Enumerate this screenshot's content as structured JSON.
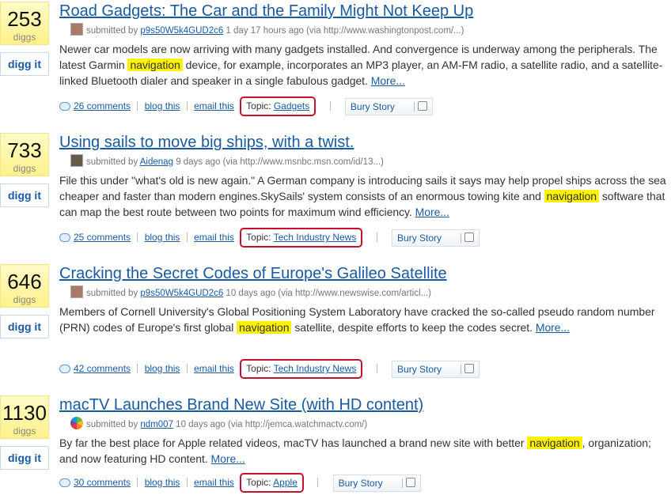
{
  "common": {
    "diggs_label": "diggs",
    "digg_button": "digg it",
    "submitted_by": "submitted by",
    "more": "More...",
    "blog_this": "blog this",
    "email_this": "email this",
    "topic_label": "Topic:",
    "bury": "Bury Story"
  },
  "stories": [
    {
      "count": "253",
      "title": "Road Gadgets: The Car and the Family Might Not Keep Up",
      "user": "p9s50W5k4GUD2c6",
      "time_source": "1 day 17 hours ago (via http://www.washingtonpost.com/...)",
      "desc_before": "Newer car models are now arriving with many gadgets installed. And convergence is underway among the peripherals. The latest Garmin",
      "highlight": "navigation",
      "desc_after": "device, for example, incorporates an MP3 player, an AM-FM radio, a satellite radio, and a satellite-linked Bluetooth dialer and speaker in a single fabulous gadget.",
      "comments": "26 comments",
      "topic": "Gadgets"
    },
    {
      "count": "733",
      "title": "Using sails to move big ships, with a twist.",
      "user": "Aidenag",
      "time_source": "9 days ago (via http://www.msnbc.msn.com/id/13...)",
      "desc_before": "File this under \"what's old is new again.\" A German company is introducing sails it says may help propel ships across the sea cheaper and faster than modern engines.SkySails' system consists of an enormous towing kite and",
      "highlight": "navigation",
      "desc_after": "software that can map the best route between two points for maximum wind efficiency.",
      "comments": "25 comments",
      "topic": "Tech Industry News"
    },
    {
      "count": "646",
      "title": "Cracking the Secret Codes of Europe's Galileo Satellite",
      "user": "p9s50W5k4GUD2c6",
      "time_source": "10 days ago (via http://www.newswise.com/articl...)",
      "desc_before": "Members of Cornell University's Global Positioning System Laboratory have cracked the so-called pseudo random number (PRN) codes of Europe's first global",
      "highlight": "navigation",
      "desc_after": "satellite, despite efforts to keep the codes secret.",
      "comments": "42 comments",
      "topic": "Tech Industry News"
    },
    {
      "count": "1130",
      "title": "macTV Launches Brand New Site (with HD content)",
      "user": "ndm007",
      "time_source": "10 days ago (via http://jemca.watchmactv.com/)",
      "desc_before": "By far the best place for Apple related videos, macTV has launched a brand new site with better",
      "highlight": "navigation",
      "desc_after": ", organization; and now featuring HD content.",
      "comments": "30 comments",
      "topic": "Apple"
    }
  ]
}
